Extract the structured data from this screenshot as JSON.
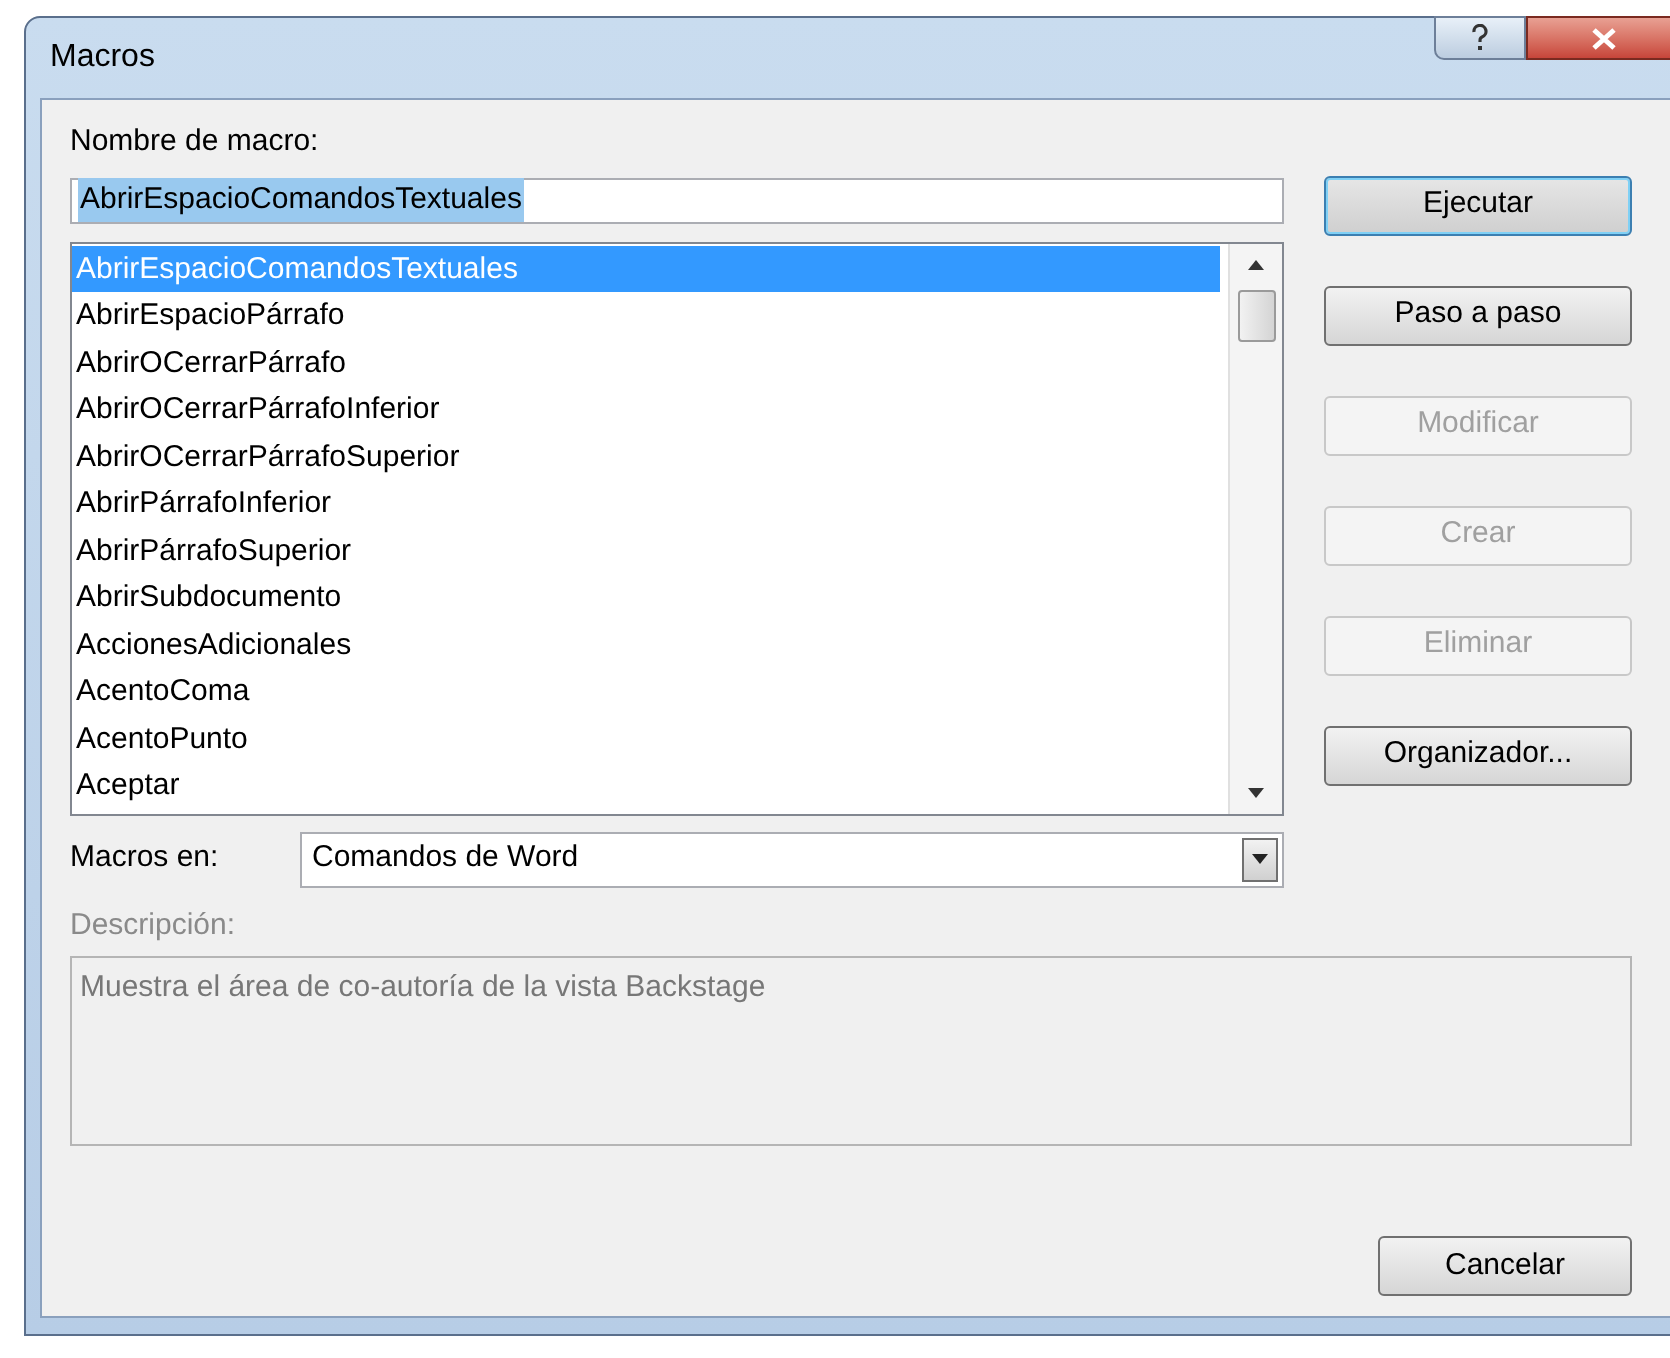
{
  "window": {
    "title": "Macros"
  },
  "name_field": {
    "label": "Nombre de macro:",
    "value": "AbrirEspacioComandosTextuales",
    "value_selected": true
  },
  "macro_list": {
    "items": [
      {
        "label": "AbrirEspacioComandosTextuales",
        "selected": true
      },
      {
        "label": "AbrirEspacioPárrafo",
        "selected": false
      },
      {
        "label": "AbrirOCerrarPárrafo",
        "selected": false
      },
      {
        "label": "AbrirOCerrarPárrafoInferior",
        "selected": false
      },
      {
        "label": "AbrirOCerrarPárrafoSuperior",
        "selected": false
      },
      {
        "label": "AbrirPárrafoInferior",
        "selected": false
      },
      {
        "label": "AbrirPárrafoSuperior",
        "selected": false
      },
      {
        "label": "AbrirSubdocumento",
        "selected": false
      },
      {
        "label": "AccionesAdicionales",
        "selected": false
      },
      {
        "label": "AcentoComa",
        "selected": false
      },
      {
        "label": "AcentoPunto",
        "selected": false
      },
      {
        "label": "Aceptar",
        "selected": false
      }
    ]
  },
  "buttons": [
    {
      "label": "Ejecutar",
      "disabled": false,
      "default": true
    },
    {
      "label": "Paso a paso",
      "disabled": false,
      "default": false
    },
    {
      "label": "Modificar",
      "disabled": true
    },
    {
      "label": "Crear",
      "disabled": true
    },
    {
      "label": "Eliminar",
      "disabled": true
    },
    {
      "label": "Organizador...",
      "disabled": false,
      "default": false
    }
  ],
  "macros_in": {
    "label": "Macros en:",
    "value": "Comandos de Word"
  },
  "description": {
    "label": "Descripción:",
    "text": "Muestra el área de co-autoría de la vista Backstage",
    "disabled": true
  },
  "cancel_button": {
    "label": "Cancelar"
  }
}
